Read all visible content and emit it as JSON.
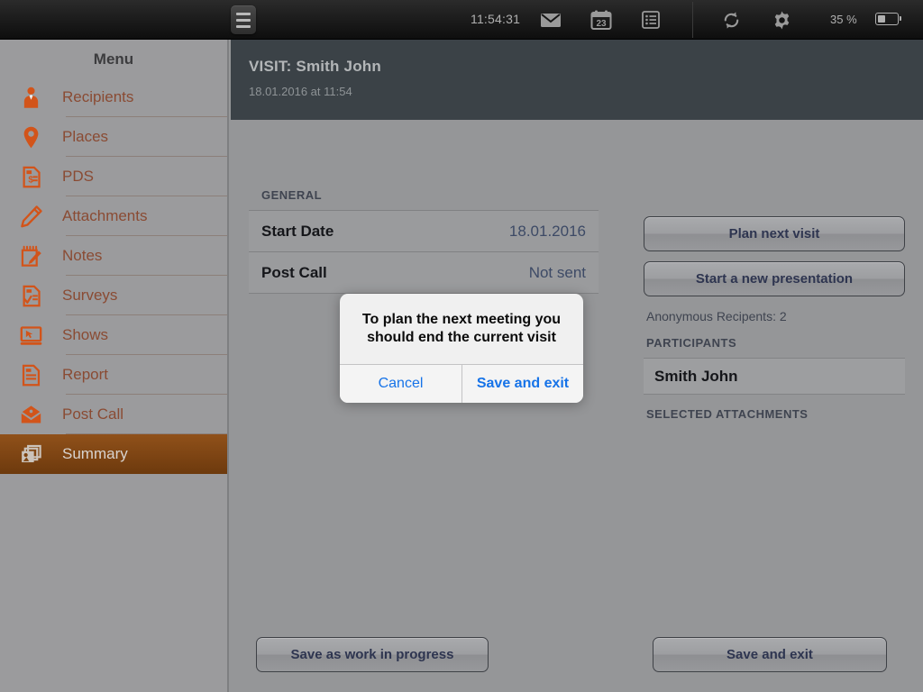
{
  "statusbar": {
    "menu_icon": "hamburger-icon",
    "time": "11:54:31",
    "mail_icon": "mail-icon",
    "calendar_icon": "calendar-icon",
    "calendar_day": "23",
    "list_icon": "list-icon",
    "sync_icon": "sync-icon",
    "settings_icon": "gear-icon",
    "battery_percent": "35 %",
    "battery_icon": "battery-icon"
  },
  "sidebar": {
    "title": "Menu",
    "items": [
      {
        "label": "Recipients",
        "icon": "user-tie-icon",
        "active": false
      },
      {
        "label": "Places",
        "icon": "map-pin-icon",
        "active": false
      },
      {
        "label": "PDS",
        "icon": "invoice-icon",
        "active": false
      },
      {
        "label": "Attachments",
        "icon": "paperclip-icon",
        "active": false
      },
      {
        "label": "Notes",
        "icon": "note-pencil-icon",
        "active": false
      },
      {
        "label": "Surveys",
        "icon": "survey-check-icon",
        "active": false
      },
      {
        "label": "Shows",
        "icon": "monitor-icon",
        "active": false
      },
      {
        "label": "Report",
        "icon": "document-icon",
        "active": false
      },
      {
        "label": "Post Call",
        "icon": "open-envelope-icon",
        "active": false
      },
      {
        "label": "Summary",
        "icon": "slides-icon",
        "active": true
      }
    ]
  },
  "header": {
    "title": "VISIT: Smith John",
    "subtitle": "18.01.2016 at 11:54"
  },
  "general": {
    "caption": "GENERAL",
    "rows": [
      {
        "key": "Start Date",
        "value": "18.01.2016"
      },
      {
        "key": "Post Call",
        "value": "Not sent"
      }
    ]
  },
  "right_panel": {
    "plan_next_visit": "Plan next visit",
    "start_presentation": "Start a new presentation",
    "anonymous_recipients": "Anonymous Recipents: 2",
    "participants_caption": "PARTICIPANTS",
    "participants": [
      "Smith John"
    ],
    "attachments_caption": "SELECTED ATTACHMENTS"
  },
  "footer": {
    "save_wip": "Save as work in progress",
    "save_exit": "Save and exit"
  },
  "modal": {
    "message": "To plan the next meeting you should end the current visit",
    "cancel": "Cancel",
    "confirm": "Save and exit"
  },
  "colors": {
    "accent_orange": "#d2541a",
    "active_nav": "#7d4413",
    "link_blue": "#1673e8",
    "header_dark": "#3b4247",
    "page_bg": "#959698"
  }
}
